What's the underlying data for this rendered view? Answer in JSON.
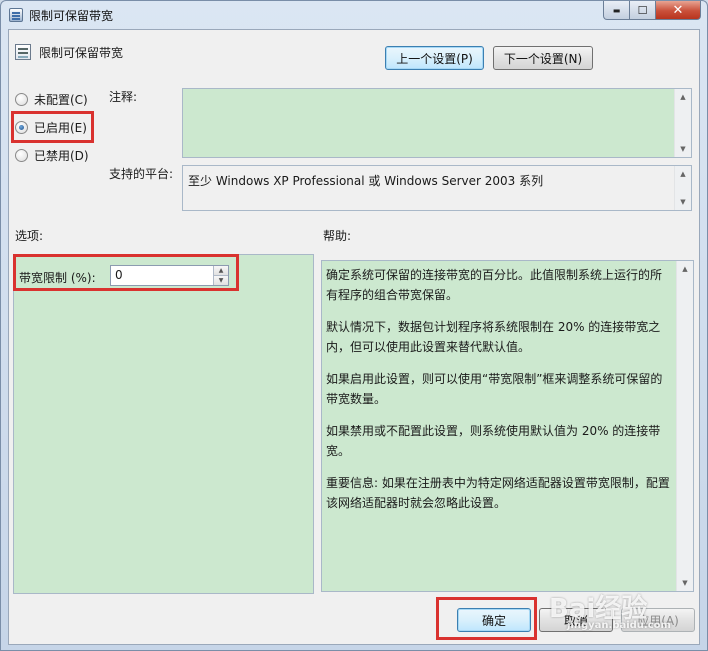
{
  "window": {
    "title": "限制可保留带宽",
    "minimize_glyph": "▬",
    "maximize_glyph": "☐",
    "close_glyph": "✕"
  },
  "policy": {
    "name": "限制可保留带宽",
    "prev_button": "上一个设置(P)",
    "next_button": "下一个设置(N)"
  },
  "state_options": [
    {
      "label": "未配置(C)",
      "checked": false
    },
    {
      "label": "已启用(E)",
      "checked": true
    },
    {
      "label": "已禁用(D)",
      "checked": false
    }
  ],
  "comment": {
    "label": "注释:",
    "value": ""
  },
  "platform": {
    "label": "支持的平台:",
    "value": "至少 Windows XP Professional 或 Windows Server 2003 系列"
  },
  "options": {
    "heading": "选项:",
    "bandwidth_label": "带宽限制 (%):",
    "bandwidth_value": "0"
  },
  "help": {
    "heading": "帮助:",
    "paragraphs": [
      "确定系统可保留的连接带宽的百分比。此值限制系统上运行的所有程序的组合带宽保留。",
      "默认情况下，数据包计划程序将系统限制在 20% 的连接带宽之内，但可以使用此设置来替代默认值。",
      "如果启用此设置，则可以使用“带宽限制”框来调整系统可保留的带宽数量。",
      "如果禁用或不配置此设置，则系统使用默认值为 20% 的连接带宽。",
      "重要信息: 如果在注册表中为特定网络适配器设置带宽限制，配置该网络适配器时就会忽略此设置。"
    ]
  },
  "footer": {
    "ok": "确定",
    "cancel": "取消",
    "apply": "应用(A)"
  },
  "watermark": {
    "brand": "Bai经验",
    "url": "jingyan.baidu.com"
  },
  "colors": {
    "highlight": "#d9322f",
    "panel_green": "#cce8cf"
  }
}
